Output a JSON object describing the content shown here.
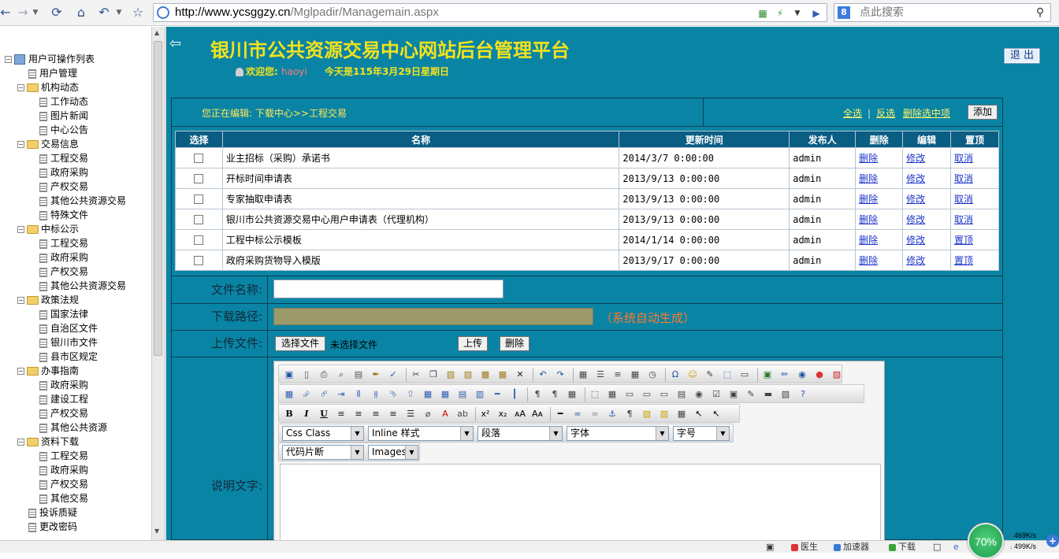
{
  "browser": {
    "url_host": "http://www.ycsggzy.cn",
    "url_path": "/Mglpadir/Managemain.aspx",
    "search_placeholder": "点此搜索"
  },
  "sidebar": {
    "root": "用户可操作列表",
    "items": [
      {
        "label": "用户管理",
        "type": "doc",
        "level": 1
      },
      {
        "label": "机构动态",
        "type": "folder",
        "level": 1
      },
      {
        "label": "工作动态",
        "type": "doc",
        "level": 2
      },
      {
        "label": "图片新闻",
        "type": "doc",
        "level": 2
      },
      {
        "label": "中心公告",
        "type": "doc",
        "level": 2
      },
      {
        "label": "交易信息",
        "type": "folder",
        "level": 1
      },
      {
        "label": "工程交易",
        "type": "doc",
        "level": 2
      },
      {
        "label": "政府采购",
        "type": "doc",
        "level": 2
      },
      {
        "label": "产权交易",
        "type": "doc",
        "level": 2
      },
      {
        "label": "其他公共资源交易",
        "type": "doc",
        "level": 2
      },
      {
        "label": "特殊文件",
        "type": "doc",
        "level": 2
      },
      {
        "label": "中标公示",
        "type": "folder",
        "level": 1
      },
      {
        "label": "工程交易",
        "type": "doc",
        "level": 2
      },
      {
        "label": "政府采购",
        "type": "doc",
        "level": 2
      },
      {
        "label": "产权交易",
        "type": "doc",
        "level": 2
      },
      {
        "label": "其他公共资源交易",
        "type": "doc",
        "level": 2
      },
      {
        "label": "政策法规",
        "type": "folder",
        "level": 1
      },
      {
        "label": "国家法律",
        "type": "doc",
        "level": 2
      },
      {
        "label": "自治区文件",
        "type": "doc",
        "level": 2
      },
      {
        "label": "银川市文件",
        "type": "doc",
        "level": 2
      },
      {
        "label": "县市区规定",
        "type": "doc",
        "level": 2
      },
      {
        "label": "办事指南",
        "type": "folder",
        "level": 1
      },
      {
        "label": "政府采购",
        "type": "doc",
        "level": 2
      },
      {
        "label": "建设工程",
        "type": "doc",
        "level": 2
      },
      {
        "label": "产权交易",
        "type": "doc",
        "level": 2
      },
      {
        "label": "其他公共资源",
        "type": "doc",
        "level": 2
      },
      {
        "label": "资料下载",
        "type": "folder",
        "level": 1
      },
      {
        "label": "工程交易",
        "type": "doc",
        "level": 2
      },
      {
        "label": "政府采购",
        "type": "doc",
        "level": 2
      },
      {
        "label": "产权交易",
        "type": "doc",
        "level": 2
      },
      {
        "label": "其他交易",
        "type": "doc",
        "level": 2
      },
      {
        "label": "投诉质疑",
        "type": "doc",
        "level": 1
      },
      {
        "label": "更改密码",
        "type": "doc",
        "level": 1
      }
    ]
  },
  "header": {
    "title": "银川市公共资源交易中心网站后台管理平台",
    "welcome": "欢迎您:",
    "username": "haoyi",
    "date_text": "今天是115年3月29日星期日",
    "logout": "退 出"
  },
  "edit_bar": {
    "breadcrumb": "您正在编辑: 下载中心>>工程交易",
    "select_all": "全选",
    "invert": "反选",
    "delete_selected": "删除选中项",
    "add": "添加"
  },
  "table": {
    "columns": [
      "选择",
      "名称",
      "更新时间",
      "发布人",
      "删除",
      "编辑",
      "置顶"
    ],
    "rows": [
      {
        "name": "业主招标（采购）承诺书",
        "time": "2014/3/7 0:00:00",
        "user": "admin",
        "del": "删除",
        "edit": "修改",
        "top": "取消"
      },
      {
        "name": "开标时间申请表",
        "time": "2013/9/13 0:00:00",
        "user": "admin",
        "del": "删除",
        "edit": "修改",
        "top": "取消"
      },
      {
        "name": "专家抽取申请表",
        "time": "2013/9/13 0:00:00",
        "user": "admin",
        "del": "删除",
        "edit": "修改",
        "top": "取消"
      },
      {
        "name": "银川市公共资源交易中心用户申请表（代理机构）",
        "time": "2013/9/13 0:00:00",
        "user": "admin",
        "del": "删除",
        "edit": "修改",
        "top": "取消"
      },
      {
        "name": "工程中标公示模板",
        "time": "2014/1/14 0:00:00",
        "user": "admin",
        "del": "删除",
        "edit": "修改",
        "top": "置顶"
      },
      {
        "name": "政府采购货物导入模版",
        "time": "2013/9/17 0:00:00",
        "user": "admin",
        "del": "删除",
        "edit": "修改",
        "top": "置顶"
      }
    ]
  },
  "form": {
    "file_name_label": "文件名称:",
    "path_label": "下载路径:",
    "path_note": "（系统自动生成）",
    "upload_label": "上传文件:",
    "choose_file": "选择文件",
    "no_file": "未选择文件",
    "upload_btn": "上传",
    "delete_btn": "删除",
    "desc_label": "说明文字:"
  },
  "editor": {
    "selects": {
      "css_class": "Css Class",
      "inline_style": "Inline 样式",
      "paragraph": "段落",
      "font": "字体",
      "size": "字号",
      "snippet": "代码片断",
      "images": "Images"
    }
  },
  "status_bar": {
    "items": [
      "医生",
      "加速器",
      "下载"
    ],
    "gauge": "70%",
    "up_speed": "469K/s",
    "down_speed": "499K/s"
  }
}
